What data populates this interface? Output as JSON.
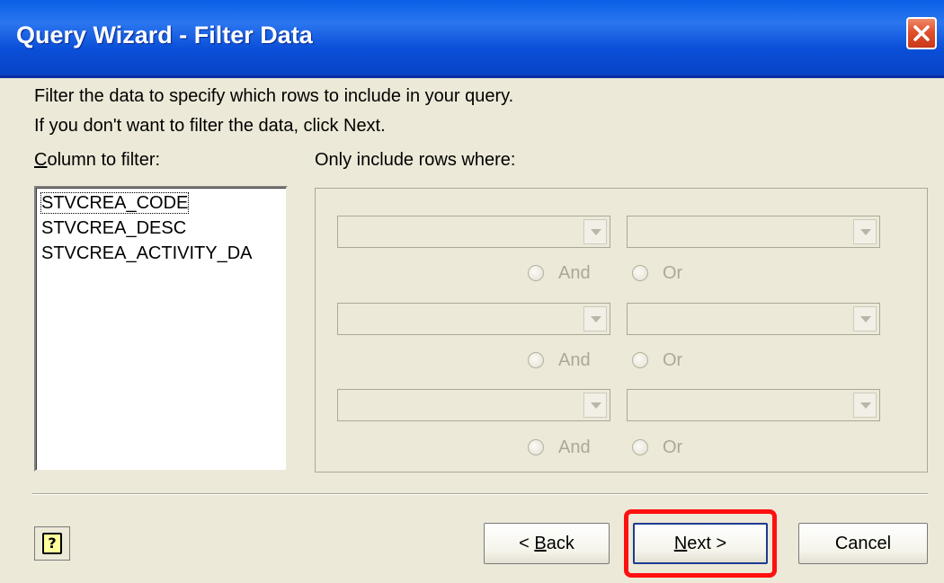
{
  "window": {
    "title": "Query Wizard - Filter Data",
    "close_icon": "close-icon"
  },
  "instructions": {
    "line1": "Filter the data to specify which rows to include in your query.",
    "line2": "If you don't want to filter the data, click Next."
  },
  "column_list": {
    "label": "Column to filter:",
    "items": [
      "STVCREA_CODE",
      "STVCREA_DESC",
      "STVCREA_ACTIVITY_DA"
    ],
    "focused_item": "STVCREA_CODE"
  },
  "criteria": {
    "label": "Only include rows where:",
    "rows": [
      {
        "operator_value": "",
        "value": "",
        "and_label": "And",
        "or_label": "Or"
      },
      {
        "operator_value": "",
        "value": "",
        "and_label": "And",
        "or_label": "Or"
      },
      {
        "operator_value": "",
        "value": "",
        "and_label": "And",
        "or_label": "Or"
      }
    ],
    "enabled": false
  },
  "buttons": {
    "help_icon": "help-icon",
    "help_glyph": "?",
    "back": "< Back",
    "next": "Next >",
    "cancel": "Cancel"
  },
  "colors": {
    "titlebar": "#0a5fe6",
    "highlight": "#ff1010",
    "dialog_bg": "#ece9d8"
  }
}
